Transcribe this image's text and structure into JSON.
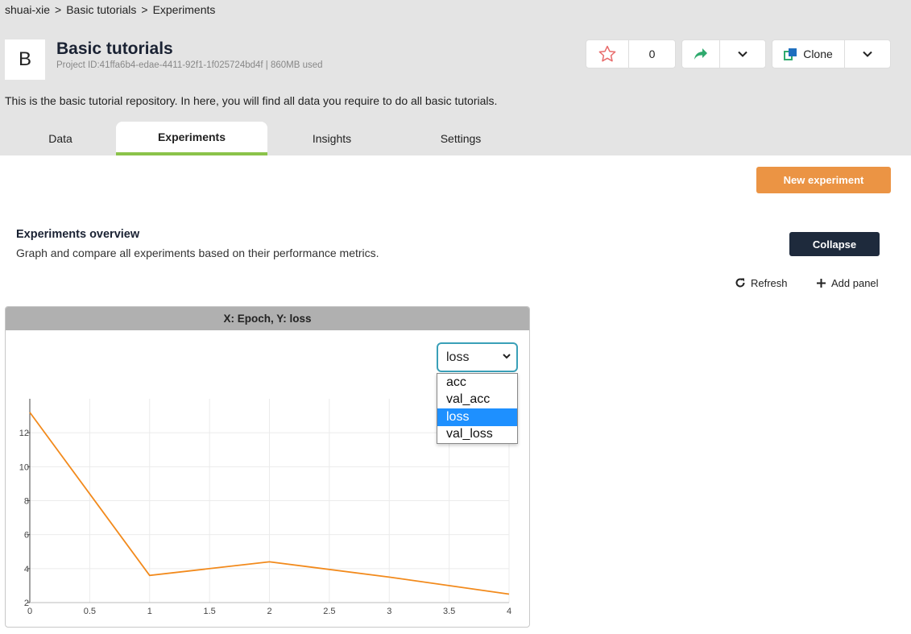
{
  "breadcrumb": {
    "user": "shuai-xie",
    "sep1": ">",
    "repo": "Basic tutorials",
    "sep2": ">",
    "page": "Experiments"
  },
  "project": {
    "avatar_letter": "B",
    "title": "Basic tutorials",
    "meta": "Project ID:41ffa6b4-edae-4411-92f1-1f025724bd4f | 860MB used",
    "description": "This is the basic tutorial repository. In here, you will find all data you require to do all basic tutorials."
  },
  "actions": {
    "star_count": "0",
    "clone_label": "Clone"
  },
  "tabs": [
    {
      "label": "Data",
      "active": false
    },
    {
      "label": "Experiments",
      "active": true
    },
    {
      "label": "Insights",
      "active": false
    },
    {
      "label": "Settings",
      "active": false
    }
  ],
  "new_experiment_label": "New experiment",
  "overview": {
    "title": "Experiments overview",
    "subtitle": "Graph and compare all experiments based on their performance metrics.",
    "collapse_label": "Collapse",
    "refresh_label": "Refresh",
    "add_panel_label": "Add panel"
  },
  "panel": {
    "title": "X: Epoch, Y: loss",
    "selected_metric": "loss",
    "metric_options": [
      "acc",
      "val_acc",
      "loss",
      "val_loss"
    ]
  },
  "colors": {
    "accent_green": "#8bc34a",
    "orange": "#eb9444",
    "dark": "#1e2a3c",
    "line": "#f28a1c",
    "select_highlight": "#1e90ff"
  },
  "chart_data": {
    "type": "line",
    "x": [
      0,
      1,
      2,
      3,
      4
    ],
    "series": [
      {
        "values": [
          13.2,
          3.6,
          4.4,
          3.5,
          2.5
        ]
      }
    ],
    "xticks": [
      "0",
      "0.5",
      "1",
      "1.5",
      "2",
      "2.5",
      "3",
      "3.5",
      "4"
    ],
    "yticks": [
      "2",
      "4",
      "6",
      "8",
      "10",
      "12"
    ],
    "xlim": [
      0,
      4
    ],
    "ylim": [
      2,
      14
    ],
    "grid": true
  }
}
